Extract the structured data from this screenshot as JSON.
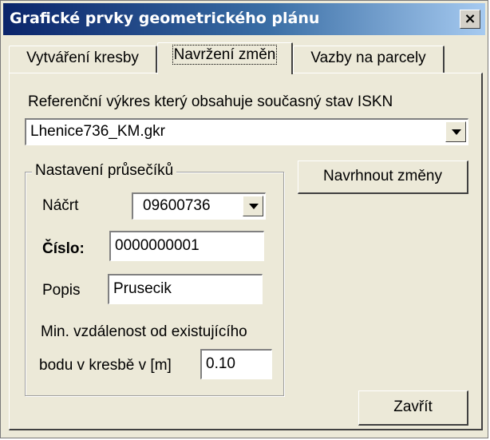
{
  "window": {
    "title": "Grafické prvky geometrického plánu",
    "close_glyph": "×"
  },
  "tabs": [
    {
      "label": "Vytváření kresby",
      "active": false
    },
    {
      "label": "Navržení změn",
      "active": true
    },
    {
      "label": "Vazby na parcely",
      "active": false
    }
  ],
  "reference": {
    "label": "Referenční výkres který obsahuje současný stav ISKN",
    "selected": "Lhenice736_KM.gkr"
  },
  "intersections": {
    "legend": "Nastavení průsečíků",
    "sketch_label": "Náčrt",
    "sketch_value": "09600736",
    "number_label": "Číslo:",
    "number_value": "0000000001",
    "description_label": "Popis",
    "description_value": "Prusecik",
    "min_distance_label_line1": "Min. vzdálenost od existujícího",
    "min_distance_label_line2": "bodu v kresbě v [m]",
    "min_distance_value": "0.10"
  },
  "buttons": {
    "propose": "Navrhnout změny",
    "close": "Zavřít"
  },
  "icons": {
    "close": "close-icon",
    "dropdown": "chevron-down-icon"
  },
  "colors": {
    "title_start": "#0a246a",
    "title_end": "#a6caf0",
    "face": "#ece9d8"
  }
}
